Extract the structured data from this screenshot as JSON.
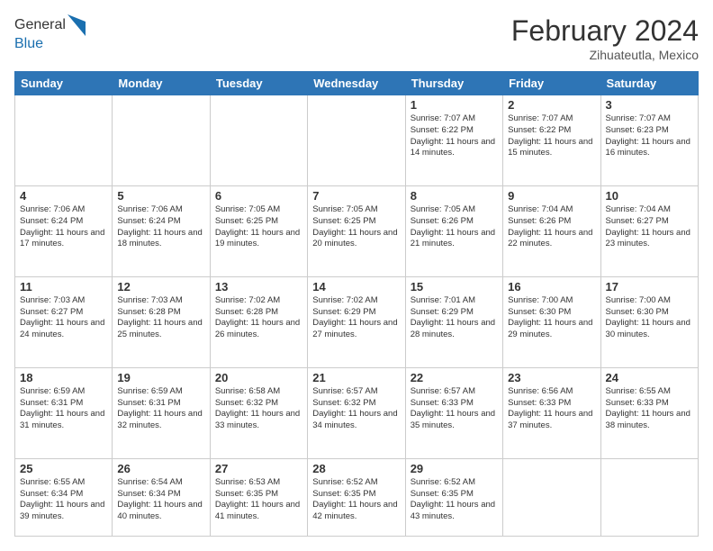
{
  "header": {
    "logo_line1": "General",
    "logo_line2": "Blue",
    "month_year": "February 2024",
    "location": "Zihuateutla, Mexico"
  },
  "days_of_week": [
    "Sunday",
    "Monday",
    "Tuesday",
    "Wednesday",
    "Thursday",
    "Friday",
    "Saturday"
  ],
  "weeks": [
    [
      {
        "day": "",
        "info": ""
      },
      {
        "day": "",
        "info": ""
      },
      {
        "day": "",
        "info": ""
      },
      {
        "day": "",
        "info": ""
      },
      {
        "day": "1",
        "info": "Sunrise: 7:07 AM\nSunset: 6:22 PM\nDaylight: 11 hours and 14 minutes."
      },
      {
        "day": "2",
        "info": "Sunrise: 7:07 AM\nSunset: 6:22 PM\nDaylight: 11 hours and 15 minutes."
      },
      {
        "day": "3",
        "info": "Sunrise: 7:07 AM\nSunset: 6:23 PM\nDaylight: 11 hours and 16 minutes."
      }
    ],
    [
      {
        "day": "4",
        "info": "Sunrise: 7:06 AM\nSunset: 6:24 PM\nDaylight: 11 hours and 17 minutes."
      },
      {
        "day": "5",
        "info": "Sunrise: 7:06 AM\nSunset: 6:24 PM\nDaylight: 11 hours and 18 minutes."
      },
      {
        "day": "6",
        "info": "Sunrise: 7:05 AM\nSunset: 6:25 PM\nDaylight: 11 hours and 19 minutes."
      },
      {
        "day": "7",
        "info": "Sunrise: 7:05 AM\nSunset: 6:25 PM\nDaylight: 11 hours and 20 minutes."
      },
      {
        "day": "8",
        "info": "Sunrise: 7:05 AM\nSunset: 6:26 PM\nDaylight: 11 hours and 21 minutes."
      },
      {
        "day": "9",
        "info": "Sunrise: 7:04 AM\nSunset: 6:26 PM\nDaylight: 11 hours and 22 minutes."
      },
      {
        "day": "10",
        "info": "Sunrise: 7:04 AM\nSunset: 6:27 PM\nDaylight: 11 hours and 23 minutes."
      }
    ],
    [
      {
        "day": "11",
        "info": "Sunrise: 7:03 AM\nSunset: 6:27 PM\nDaylight: 11 hours and 24 minutes."
      },
      {
        "day": "12",
        "info": "Sunrise: 7:03 AM\nSunset: 6:28 PM\nDaylight: 11 hours and 25 minutes."
      },
      {
        "day": "13",
        "info": "Sunrise: 7:02 AM\nSunset: 6:28 PM\nDaylight: 11 hours and 26 minutes."
      },
      {
        "day": "14",
        "info": "Sunrise: 7:02 AM\nSunset: 6:29 PM\nDaylight: 11 hours and 27 minutes."
      },
      {
        "day": "15",
        "info": "Sunrise: 7:01 AM\nSunset: 6:29 PM\nDaylight: 11 hours and 28 minutes."
      },
      {
        "day": "16",
        "info": "Sunrise: 7:00 AM\nSunset: 6:30 PM\nDaylight: 11 hours and 29 minutes."
      },
      {
        "day": "17",
        "info": "Sunrise: 7:00 AM\nSunset: 6:30 PM\nDaylight: 11 hours and 30 minutes."
      }
    ],
    [
      {
        "day": "18",
        "info": "Sunrise: 6:59 AM\nSunset: 6:31 PM\nDaylight: 11 hours and 31 minutes."
      },
      {
        "day": "19",
        "info": "Sunrise: 6:59 AM\nSunset: 6:31 PM\nDaylight: 11 hours and 32 minutes."
      },
      {
        "day": "20",
        "info": "Sunrise: 6:58 AM\nSunset: 6:32 PM\nDaylight: 11 hours and 33 minutes."
      },
      {
        "day": "21",
        "info": "Sunrise: 6:57 AM\nSunset: 6:32 PM\nDaylight: 11 hours and 34 minutes."
      },
      {
        "day": "22",
        "info": "Sunrise: 6:57 AM\nSunset: 6:33 PM\nDaylight: 11 hours and 35 minutes."
      },
      {
        "day": "23",
        "info": "Sunrise: 6:56 AM\nSunset: 6:33 PM\nDaylight: 11 hours and 37 minutes."
      },
      {
        "day": "24",
        "info": "Sunrise: 6:55 AM\nSunset: 6:33 PM\nDaylight: 11 hours and 38 minutes."
      }
    ],
    [
      {
        "day": "25",
        "info": "Sunrise: 6:55 AM\nSunset: 6:34 PM\nDaylight: 11 hours and 39 minutes."
      },
      {
        "day": "26",
        "info": "Sunrise: 6:54 AM\nSunset: 6:34 PM\nDaylight: 11 hours and 40 minutes."
      },
      {
        "day": "27",
        "info": "Sunrise: 6:53 AM\nSunset: 6:35 PM\nDaylight: 11 hours and 41 minutes."
      },
      {
        "day": "28",
        "info": "Sunrise: 6:52 AM\nSunset: 6:35 PM\nDaylight: 11 hours and 42 minutes."
      },
      {
        "day": "29",
        "info": "Sunrise: 6:52 AM\nSunset: 6:35 PM\nDaylight: 11 hours and 43 minutes."
      },
      {
        "day": "",
        "info": ""
      },
      {
        "day": "",
        "info": ""
      }
    ]
  ]
}
